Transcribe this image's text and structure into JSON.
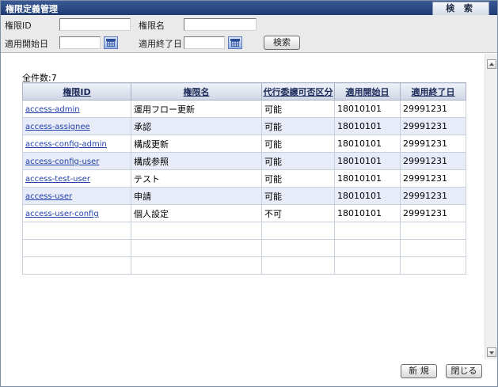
{
  "header": {
    "title": "権限定義管理",
    "tab_label": "検 索"
  },
  "search": {
    "authority_id_label": "権限ID",
    "authority_id_value": "",
    "authority_name_label": "権限名",
    "authority_name_value": "",
    "start_date_label": "適用開始日",
    "start_date_value": "",
    "end_date_label": "適用終了日",
    "end_date_value": "",
    "search_button": "検索"
  },
  "results": {
    "count_text": "全件数:7",
    "columns": [
      "権限ID",
      "権限名",
      "代行委譲可否区分",
      "適用開始日",
      "適用終了日"
    ],
    "rows": [
      {
        "id": "access-admin",
        "name": "運用フロー更新",
        "delegation": "可能",
        "start": "18010101",
        "end": "29991231"
      },
      {
        "id": "access-assignee",
        "name": "承認",
        "delegation": "可能",
        "start": "18010101",
        "end": "29991231"
      },
      {
        "id": "access-config-admin",
        "name": "構成更新",
        "delegation": "可能",
        "start": "18010101",
        "end": "29991231"
      },
      {
        "id": "access-config-user",
        "name": "構成参照",
        "delegation": "可能",
        "start": "18010101",
        "end": "29991231"
      },
      {
        "id": "access-test-user",
        "name": "テスト",
        "delegation": "可能",
        "start": "18010101",
        "end": "29991231"
      },
      {
        "id": "access-user",
        "name": "申請",
        "delegation": "可能",
        "start": "18010101",
        "end": "29991231"
      },
      {
        "id": "access-user-config",
        "name": "個人設定",
        "delegation": "不可",
        "start": "18010101",
        "end": "29991231"
      }
    ]
  },
  "footer": {
    "new_button": "新 規",
    "close_button": "閉じる"
  }
}
